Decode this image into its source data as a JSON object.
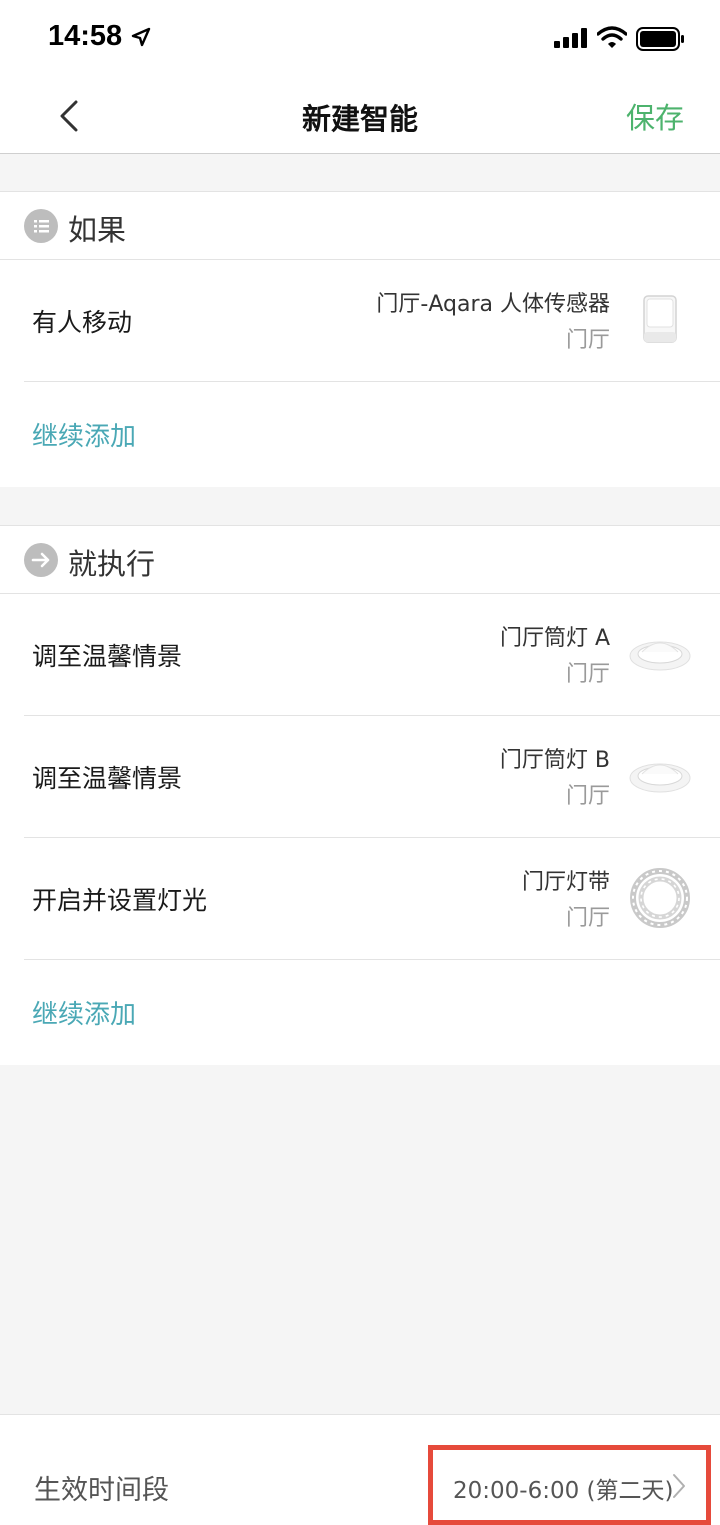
{
  "status_bar": {
    "time": "14:58",
    "icons": [
      "location-arrow-icon",
      "signal-icon",
      "wifi-icon",
      "battery-icon"
    ]
  },
  "nav": {
    "back_icon": "chevron-left-icon",
    "title": "新建智能",
    "save_label": "保存"
  },
  "if_section": {
    "label": "如果",
    "icon": "list-icon",
    "rows": [
      {
        "action": "有人移动",
        "device": "门厅-Aqara 人体传感器",
        "room": "门厅",
        "thumb": "motion-sensor"
      }
    ],
    "add_label": "继续添加"
  },
  "then_section": {
    "label": "就执行",
    "icon": "arrow-right-icon",
    "rows": [
      {
        "action": "调至温馨情景",
        "device": "门厅筒灯 A",
        "room": "门厅",
        "thumb": "downlight"
      },
      {
        "action": "调至温馨情景",
        "device": "门厅筒灯 B",
        "room": "门厅",
        "thumb": "downlight"
      },
      {
        "action": "开启并设置灯光",
        "device": "门厅灯带",
        "room": "门厅",
        "thumb": "light-strip"
      }
    ],
    "add_label": "继续添加"
  },
  "bottom": {
    "label": "生效时间段",
    "value": "20:00-6:00 (第二天)"
  },
  "colors": {
    "accent_green": "#4db36d",
    "link_teal": "#4aa8b5",
    "highlight_red": "#e64a3b"
  }
}
